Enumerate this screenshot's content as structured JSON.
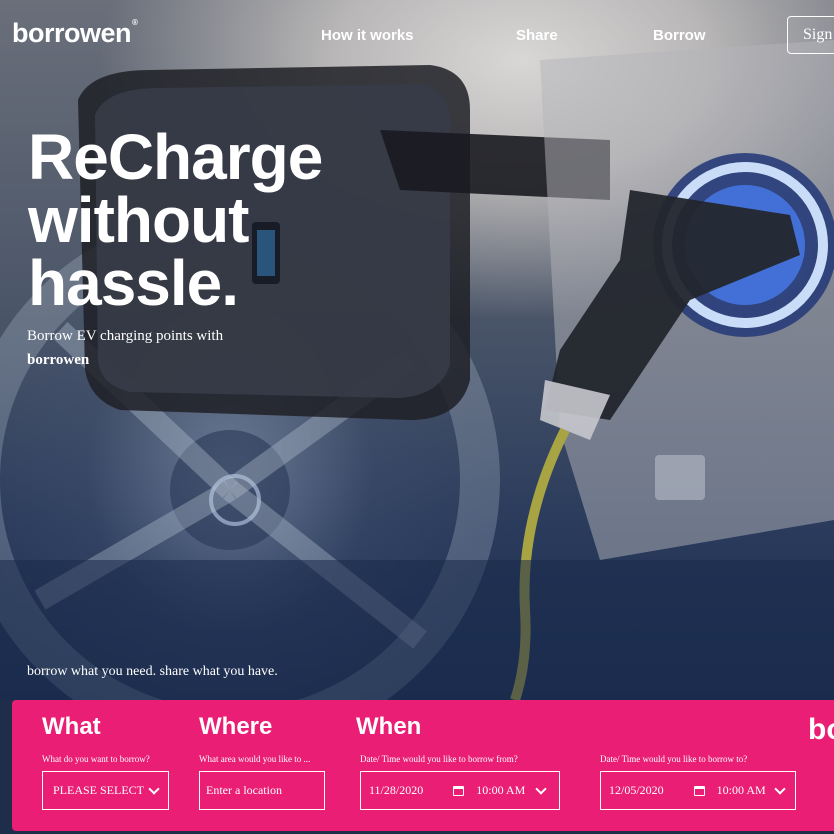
{
  "header": {
    "logo": "borrowen",
    "logo_mark": "®",
    "nav": [
      "How it works",
      "Share",
      "Borrow"
    ],
    "sign_label": "Sign"
  },
  "hero": {
    "headline": [
      "ReCharge",
      "without",
      "hassle."
    ],
    "subtitle": "Borrow EV charging points with",
    "subtitle_brand": "borrowen",
    "tagline": "borrow what you need. share what you have."
  },
  "booking": {
    "what": {
      "title": "What",
      "question": "What do you want to borrow?",
      "selected": "PLEASE SELECT"
    },
    "where": {
      "title": "Where",
      "question": "What area would you like to ...",
      "placeholder": "Enter a location"
    },
    "when": {
      "title": "When",
      "from": {
        "question": "Date/ Time would you like to borrow from?",
        "date": "11/28/2020",
        "time": "10:00 AM"
      },
      "to": {
        "question": "Date/ Time would you like to borrow to?",
        "date": "12/05/2020",
        "time": "10:00 AM"
      }
    },
    "brand_peek": "bo"
  },
  "colors": {
    "accent": "#e91e74",
    "hero_dark": "#1c2e52",
    "text": "#ffffff"
  }
}
